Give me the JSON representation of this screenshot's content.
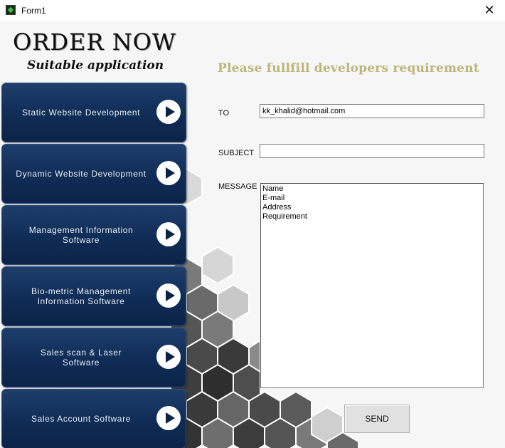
{
  "window": {
    "title": "Form1"
  },
  "logo": {
    "title": "ORDER NOW",
    "subtitle": "Suitable application"
  },
  "headline": "Please fullfill developers requirement",
  "services": [
    {
      "label": "Static Website Development"
    },
    {
      "label": "Dynamic Website Development"
    },
    {
      "label": "Management Information\nSoftware"
    },
    {
      "label": "Bio-metric Management\nInformation Software"
    },
    {
      "label": "Sales scan & Laser\nSoftware"
    },
    {
      "label": "Sales Account Software"
    }
  ],
  "form": {
    "to_label": "TO",
    "to_value": "kk_khalid@hotmail.com",
    "subject_label": "SUBJECT",
    "subject_value": "",
    "message_label": "MESSAGE",
    "message_lines": [
      "Name",
      "E-mail",
      "Address",
      "Requirement"
    ],
    "send_label": "SEND"
  }
}
